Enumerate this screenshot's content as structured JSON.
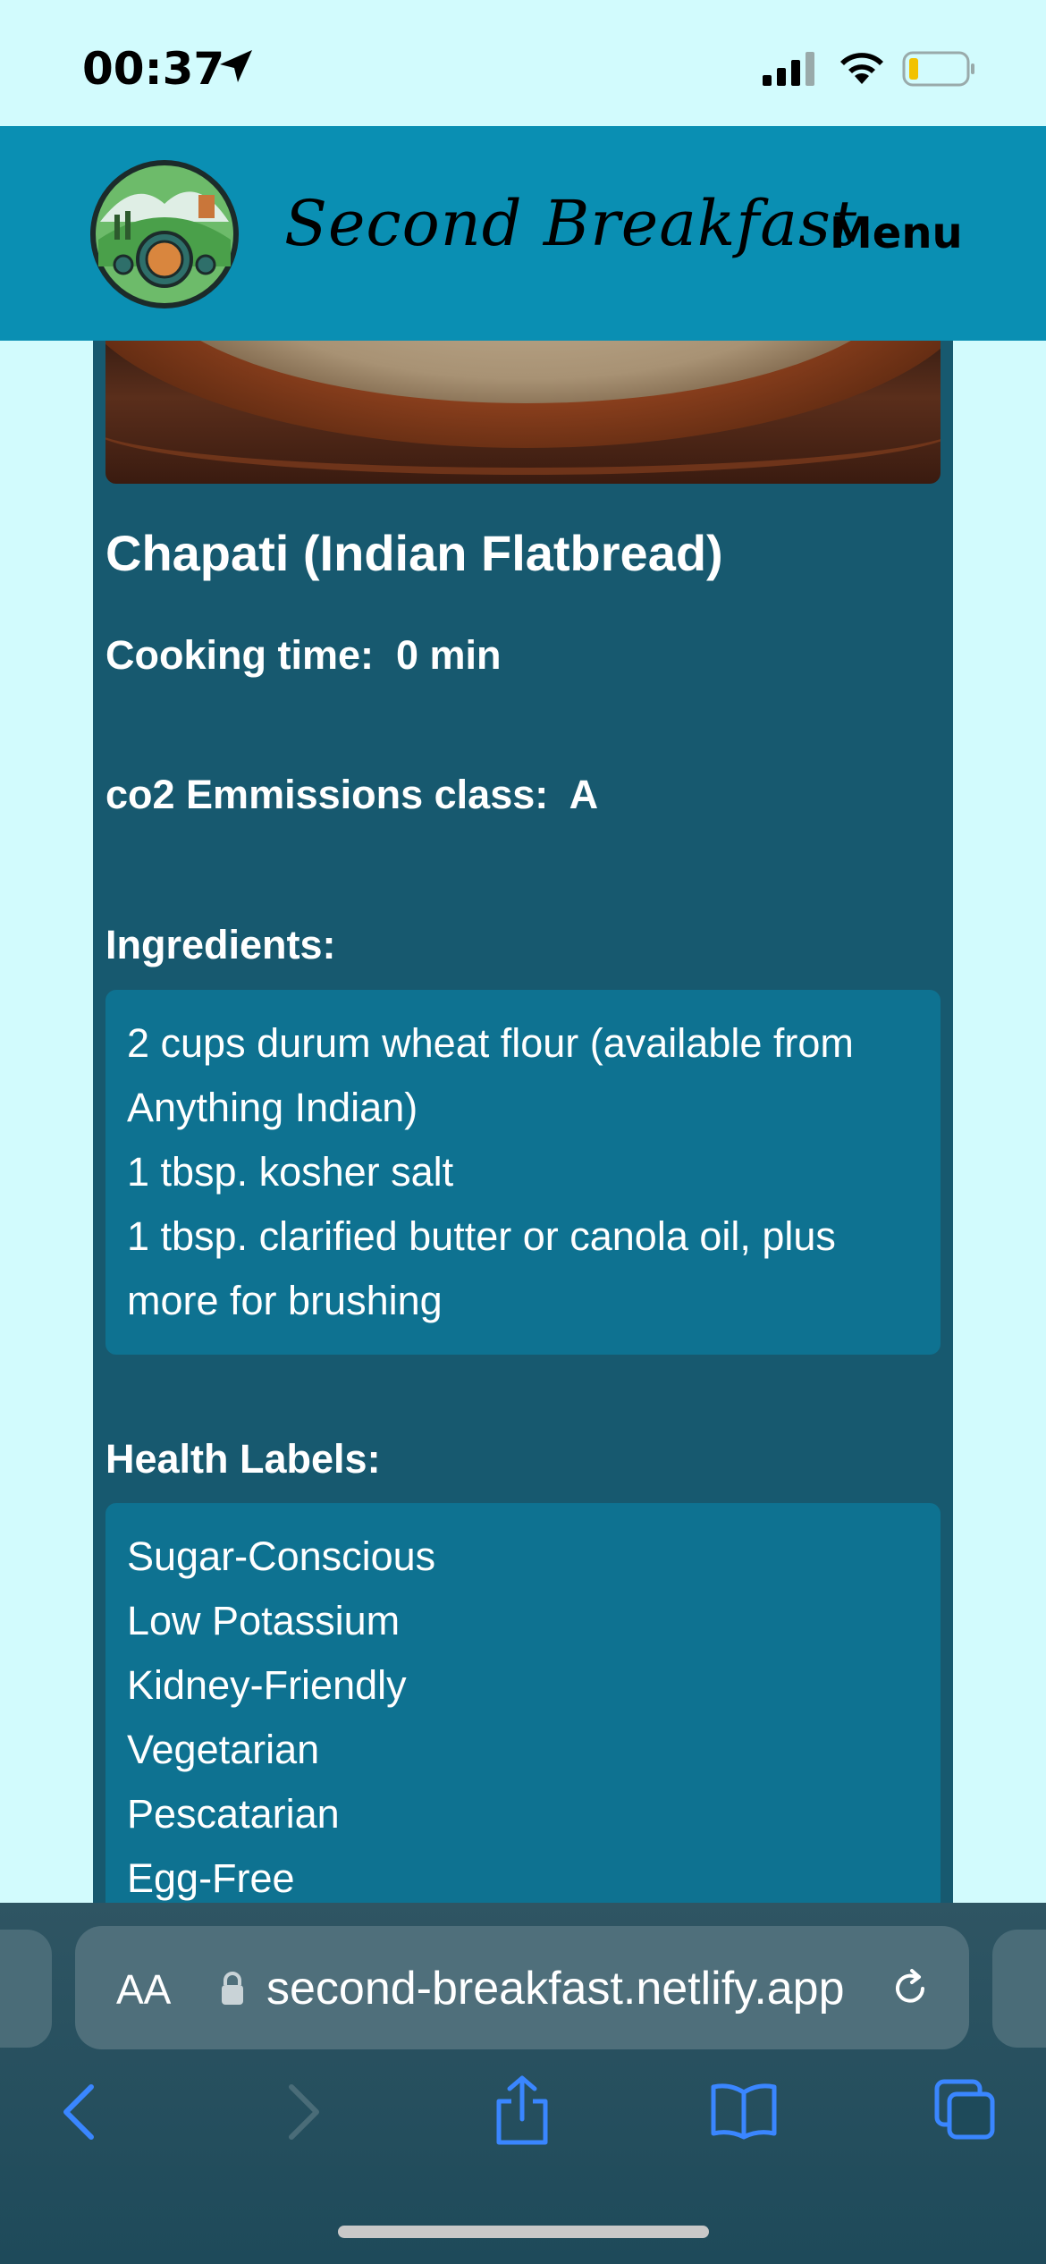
{
  "status_bar": {
    "time": "00:37",
    "location_icon": "location-arrow-icon",
    "signal_icon": "cellular-signal-icon",
    "wifi_icon": "wifi-icon",
    "battery_icon": "battery-low-icon"
  },
  "header": {
    "logo_icon": "hobbit-hole-logo-icon",
    "site_title": "Second Breakfast",
    "menu_label": "Menu",
    "background_color": "#0a8fb3"
  },
  "recipe": {
    "title": "Chapati (Indian Flatbread)",
    "cooking_time_label": "Cooking time:",
    "cooking_time_value": "0 min",
    "co2_label": "co2 Emmissions class:",
    "co2_value": "A",
    "ingredients_heading": "Ingredients:",
    "ingredients": [
      "2 cups durum wheat flour (available from Anything Indian)",
      "1 tbsp. kosher salt",
      "1 tbsp. clarified butter or canola oil, plus more for brushing"
    ],
    "health_heading": "Health Labels:",
    "health_labels": [
      "Sugar-Conscious",
      "Low Potassium",
      "Kidney-Friendly",
      "Vegetarian",
      "Pescatarian",
      "Egg-Free"
    ],
    "card_color": "#17596f",
    "list_box_color": "#0e7291"
  },
  "browser": {
    "text_size_label": "AA",
    "url": "second-breakfast.netlify.app",
    "lock_icon": "lock-icon",
    "reload_icon": "reload-icon",
    "toolbar": {
      "back_icon": "chevron-left-icon",
      "forward_icon": "chevron-right-icon",
      "share_icon": "share-icon",
      "bookmarks_icon": "book-icon",
      "tabs_icon": "tabs-icon"
    },
    "accent_color": "#3a86ff"
  }
}
